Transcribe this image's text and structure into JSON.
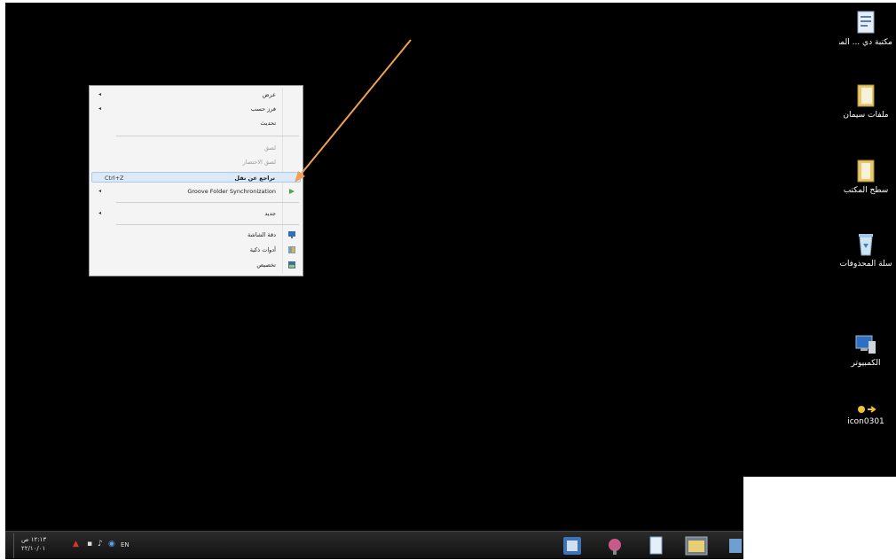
{
  "desktop_icons": [
    {
      "name": "doc-icon",
      "label": "مكتبة دي ... المصدر"
    },
    {
      "name": "folder-icon",
      "label": "ملفات سيمان"
    },
    {
      "name": "folder-icon",
      "label": "سطح المكتب"
    },
    {
      "name": "recycle-bin-icon",
      "label": "سلة المحذوفات"
    },
    {
      "name": "computer-icon",
      "label": "الكمبيوتر"
    },
    {
      "name": "icon-file-icon",
      "label": "icon0301"
    }
  ],
  "context_menu": {
    "items": [
      {
        "label": "عرض",
        "submenu": true,
        "disabled": false
      },
      {
        "label": "فرز حسب",
        "submenu": true,
        "disabled": false
      },
      {
        "label": "تحديث",
        "submenu": false,
        "disabled": false
      },
      {
        "label": "لصق",
        "submenu": false,
        "disabled": true
      },
      {
        "label": "لصق الاختصار",
        "submenu": false,
        "disabled": true
      },
      {
        "label": "تراجع عن نقل",
        "shortcut": "Ctrl+Z",
        "highlighted": true
      },
      {
        "label": "Groove Folder Synchronization",
        "submenu": true
      },
      {
        "label": "جديد",
        "submenu": true
      },
      {
        "label": "دقة الشاشة",
        "icon": "screen-resolution-icon"
      },
      {
        "label": "أدوات ذكية",
        "icon": "gadgets-icon"
      },
      {
        "label": "تخصيص",
        "icon": "personalize-icon"
      }
    ]
  },
  "taskbar": {
    "clock_time": "١٢:١٣ ص",
    "clock_date": "٢٢/١٠/٠١",
    "language": "EN"
  },
  "colors": {
    "desktop": "#000000",
    "annotation_arrow": "#f0a050",
    "menu_bg": "#f4f4f4",
    "menu_highlight": "#dde9f6"
  }
}
